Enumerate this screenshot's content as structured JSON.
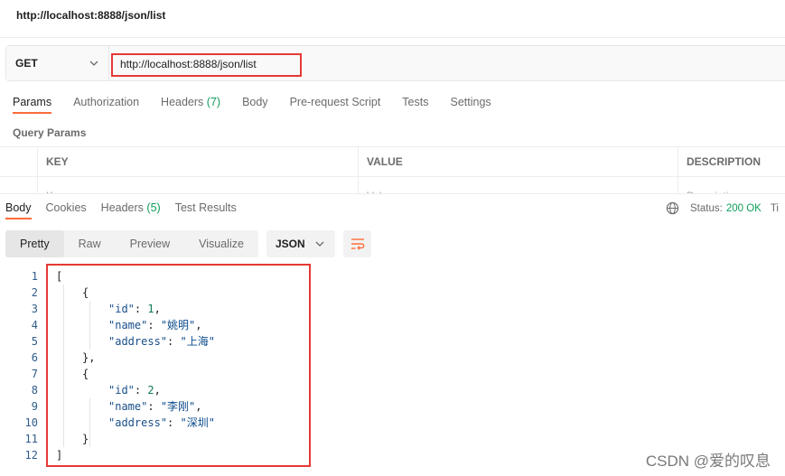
{
  "window": {
    "title": "http://localhost:8888/json/list"
  },
  "request": {
    "method": "GET",
    "url": "http://localhost:8888/json/list"
  },
  "request_tabs": [
    {
      "label": "Params",
      "active": true
    },
    {
      "label": "Authorization"
    },
    {
      "label": "Headers",
      "count": "(7)"
    },
    {
      "label": "Body"
    },
    {
      "label": "Pre-request Script"
    },
    {
      "label": "Tests"
    },
    {
      "label": "Settings"
    }
  ],
  "query_params": {
    "title": "Query Params",
    "columns": [
      "KEY",
      "VALUE",
      "DESCRIPTION"
    ],
    "placeholders": [
      "Key",
      "Value",
      "Description"
    ]
  },
  "response_tabs": [
    {
      "label": "Body",
      "active": true
    },
    {
      "label": "Cookies"
    },
    {
      "label": "Headers",
      "count": "(5)"
    },
    {
      "label": "Test Results"
    }
  ],
  "status": {
    "label": "Status:",
    "value": "200 OK",
    "time_label": "Ti"
  },
  "view_modes": [
    "Pretty",
    "Raw",
    "Preview",
    "Visualize"
  ],
  "format": "JSON",
  "code": {
    "line_numbers": [
      "1",
      "2",
      "3",
      "4",
      "5",
      "6",
      "7",
      "8",
      "9",
      "10",
      "11",
      "12"
    ],
    "lines": [
      {
        "indent": 0,
        "text": "["
      },
      {
        "indent": 1,
        "text": "{"
      },
      {
        "indent": 2,
        "key": "\"id\"",
        "num": "1"
      },
      {
        "indent": 2,
        "key": "\"name\"",
        "str": "\"姚明\""
      },
      {
        "indent": 2,
        "key": "\"address\"",
        "str": "\"上海\"",
        "last": true
      },
      {
        "indent": 1,
        "text": "},"
      },
      {
        "indent": 1,
        "text": "{"
      },
      {
        "indent": 2,
        "key": "\"id\"",
        "num": "2"
      },
      {
        "indent": 2,
        "key": "\"name\"",
        "str": "\"李刚\""
      },
      {
        "indent": 2,
        "key": "\"address\"",
        "str": "\"深圳\"",
        "last": true
      },
      {
        "indent": 1,
        "text": "}"
      },
      {
        "indent": 0,
        "text": "]"
      }
    ]
  },
  "watermark": "CSDN @爱的叹息",
  "colors": {
    "accent": "#ff6c37",
    "highlight": "#e53935",
    "success": "#0f9d58"
  }
}
